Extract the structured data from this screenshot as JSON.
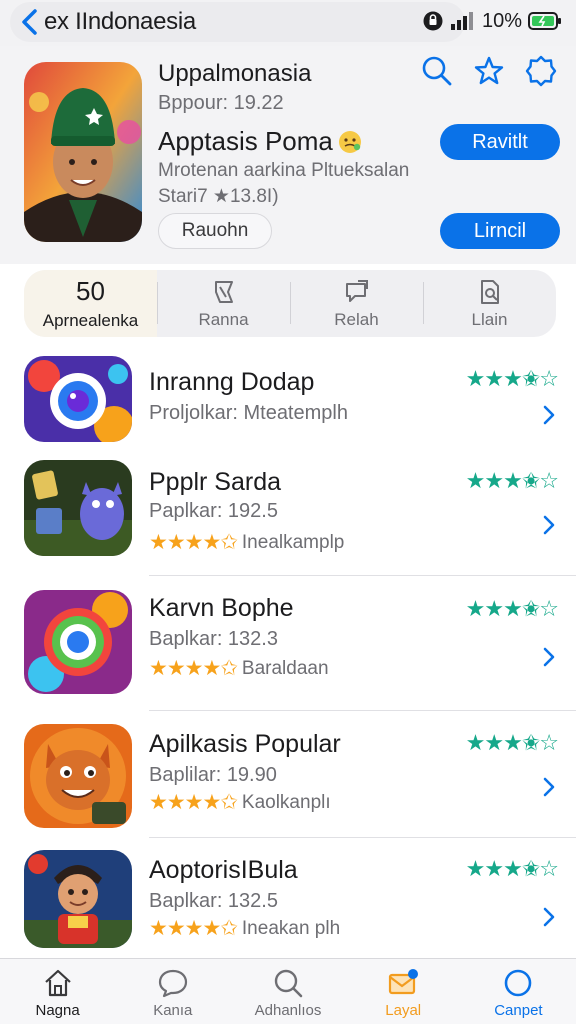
{
  "status_bar": {
    "title": "ex IIndonaesia",
    "battery_text": "10%"
  },
  "hero": {
    "app_name": "Uppalmonasia",
    "sub": "Bppour: 19.22",
    "title2": "Apptasis Poma",
    "desc": "Mrotenan aarkina Pltueksalan",
    "rating": "Stari7 ★13.8I)",
    "secondary_button": "Rauohn",
    "get_button_1": "Ravitlt",
    "get_button_2": "Lirncil"
  },
  "segments": [
    {
      "big": "50",
      "label": "Aprnealenka"
    },
    {
      "label": "Ranna"
    },
    {
      "label": "Relah"
    },
    {
      "label": "Llain"
    }
  ],
  "apps": [
    {
      "title": "Inranng Dodap",
      "sub": "Proljolkar: Mteatemplh",
      "rating_text": "",
      "rating": 3.5
    },
    {
      "title": "Ppplr Sarda",
      "sub": "Paplkar: 192.5",
      "rating_text": "Inealkamplp",
      "rating": 3.5
    },
    {
      "title": "Karvn Bophe",
      "sub": "Baplkar: 132.3",
      "rating_text": "Baraldaan",
      "rating": 3.5
    },
    {
      "title": "Apilkasis Popular",
      "sub": "Baplilar: 19.90",
      "rating_text": "Kaolkanplı",
      "rating": 3.5
    },
    {
      "title": "AoptorisIBula",
      "sub": "Baplkar: 132.5",
      "rating_text": "Ineakan plh",
      "rating": 3.5
    }
  ],
  "tabs": [
    {
      "label": "Nagna",
      "icon": "home-icon"
    },
    {
      "label": "Kanıa",
      "icon": "chat-icon"
    },
    {
      "label": "Adhanlıos",
      "icon": "search-icon"
    },
    {
      "label": "Layal",
      "icon": "mail-icon"
    },
    {
      "label": "Canpet",
      "icon": "circle-icon"
    }
  ],
  "colors": {
    "accent_blue": "#0a72e8",
    "star_green": "#16a88a",
    "star_orange": "#f7a21b",
    "tab_orange": "#f29c1f"
  }
}
